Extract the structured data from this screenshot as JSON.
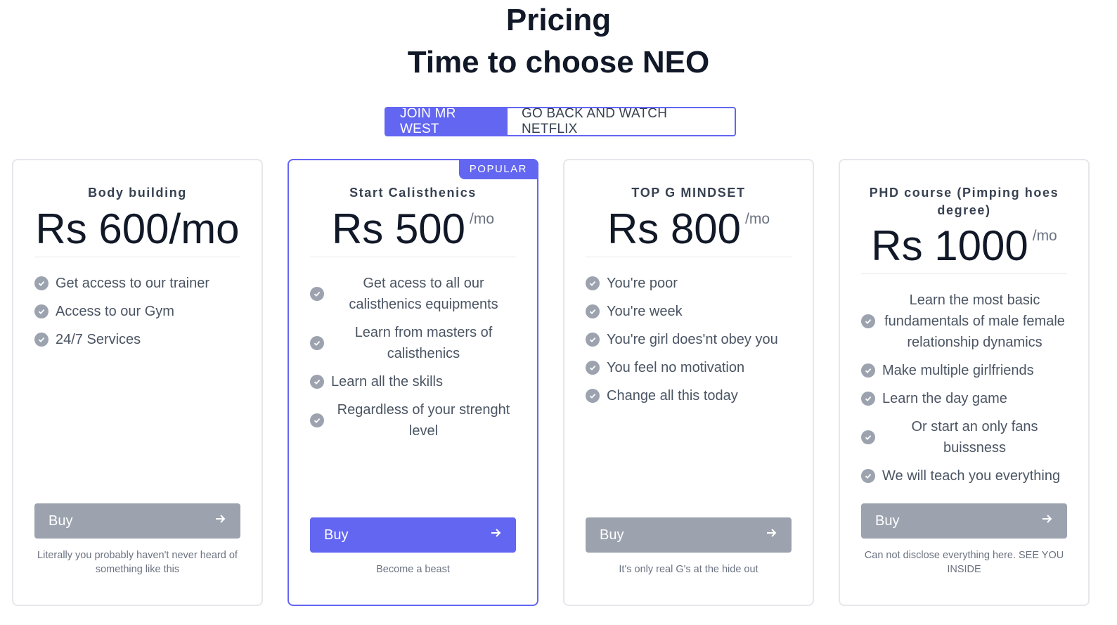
{
  "header": {
    "title": "Pricing",
    "subtitle": "Time to choose NEO"
  },
  "toggle": {
    "active_label": "JOIN MR WEST",
    "inactive_label": "GO BACK AND WATCH NETFLIX"
  },
  "colors": {
    "accent": "#6366f1",
    "button_gray": "#9ca3af",
    "border": "#e5e7eb"
  },
  "plans": [
    {
      "name": "Body building",
      "price": "Rs 600/mo",
      "unit": "",
      "features": [
        "Get access to our trainer",
        "Access to our Gym",
        "24/7 Services"
      ],
      "buy_label": "Buy",
      "note": "Literally you probably haven't never heard of something like this"
    },
    {
      "name": "Start Calisthenics",
      "badge": "POPULAR",
      "price": "Rs 500",
      "unit": "/mo",
      "features": [
        "Get acess to all our calisthenics equipments",
        "Learn from masters of calisthenics",
        "Learn all the skills",
        "Regardless of your strenght level"
      ],
      "buy_label": "Buy",
      "note": "Become a beast"
    },
    {
      "name": "TOP G MINDSET",
      "price": "Rs 800",
      "unit": "/mo",
      "features": [
        "You're poor",
        "You're week",
        "You're girl does'nt obey you",
        "You feel no motivation",
        "Change all this today"
      ],
      "buy_label": "Buy",
      "note": "It's only real G's at the hide out"
    },
    {
      "name": "PHD course (Pimping hoes degree)",
      "price": "Rs 1000",
      "unit": "/mo",
      "features": [
        "Learn the most basic fundamentals of male female relationship dynamics",
        "Make multiple girlfriends",
        "Learn the day game",
        "Or start an only fans buissness",
        "We will teach you everything"
      ],
      "buy_label": "Buy",
      "note": "Can not disclose everything here. SEE YOU INSIDE"
    }
  ]
}
